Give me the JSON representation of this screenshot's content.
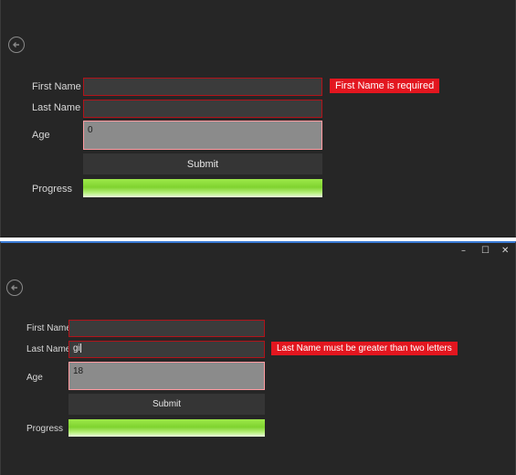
{
  "top": {
    "form": {
      "first_name_label": "First Name",
      "last_name_label": "Last Name",
      "age_label": "Age",
      "progress_label": "Progress",
      "first_name_value": "",
      "last_name_value": "",
      "age_value": "0",
      "submit_label": "Submit",
      "error": "First Name is required",
      "progress_fraction": 1.0
    }
  },
  "bottom": {
    "window_controls": {
      "minimize": "–",
      "maximize": "☐",
      "close": "✕"
    },
    "form": {
      "first_name_label": "First Name",
      "last_name_label": "Last Name",
      "age_label": "Age",
      "progress_label": "Progress",
      "first_name_value": "",
      "last_name_value": "gi",
      "age_value": "18",
      "submit_label": "Submit",
      "error": "Last Name must be greater than two letters",
      "progress_fraction": 1.0
    }
  },
  "icons": {
    "back": "back-arrow-circle-icon"
  },
  "colors": {
    "background": "#262626",
    "field_background": "#3b3b3b",
    "field_error_border": "#b1131a",
    "error_badge": "#e3161f",
    "progress_green": "#7fd32f"
  }
}
